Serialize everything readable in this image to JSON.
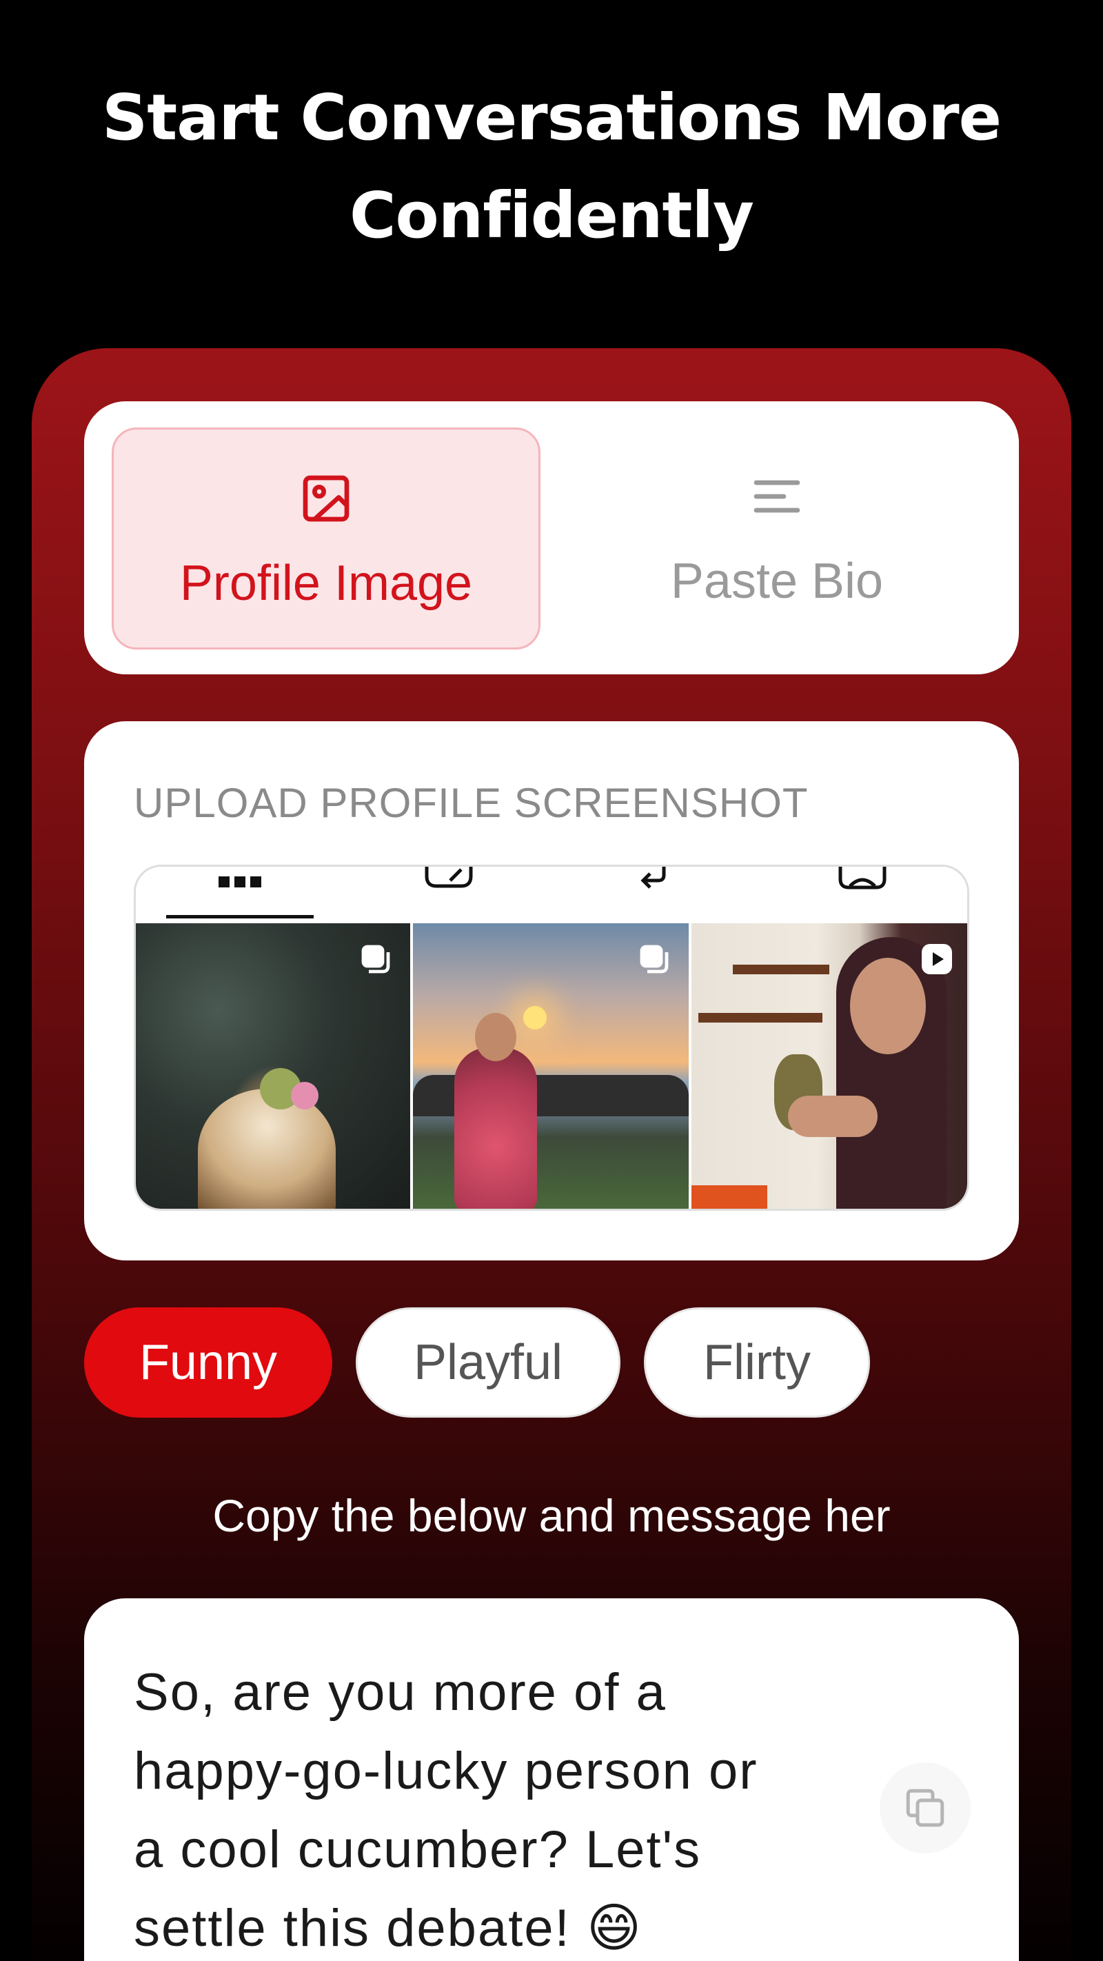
{
  "header": {
    "title_line1": "Start Conversations More",
    "title_line2": "Confidently"
  },
  "mode_toggle": {
    "options": [
      {
        "label": "Profile Image",
        "icon": "image-icon",
        "active": true
      },
      {
        "label": "Paste Bio",
        "icon": "text-lines-icon",
        "active": false
      }
    ]
  },
  "upload": {
    "label": "UPLOAD PROFILE SCREENSHOT",
    "photos": [
      {
        "icon": "carousel-icon"
      },
      {
        "icon": "carousel-icon"
      },
      {
        "icon": "reel-play-icon"
      }
    ]
  },
  "tones": [
    {
      "label": "Funny",
      "active": true
    },
    {
      "label": "Playful",
      "active": false
    },
    {
      "label": "Flirty",
      "active": false
    }
  ],
  "instruction": "Copy the below and message her",
  "message": {
    "line1": "So, are you more of a",
    "line2": "happy-go-lucky person or",
    "line3": "a cool cucumber? Let's",
    "line4": "settle this debate! 😄"
  },
  "colors": {
    "accent": "#e10a0f",
    "accent_soft": "#fbe5e7",
    "panel_top": "#9c1418",
    "background": "#000000"
  }
}
